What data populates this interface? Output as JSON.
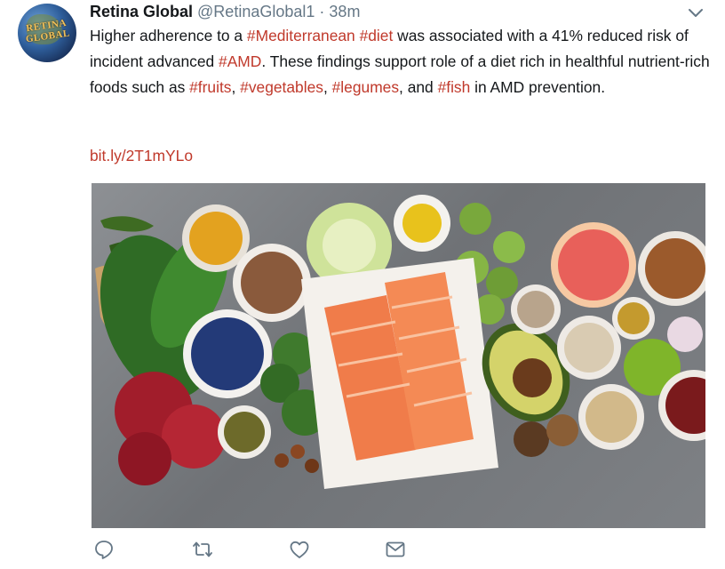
{
  "tweet": {
    "avatar_text": "RETINA GLOBAL",
    "display_name": "Retina Global",
    "handle": "@RetinaGlobal1",
    "separator": "·",
    "time": "38m",
    "text": {
      "p1": "Higher adherence to a ",
      "h1": "#Mediterranean",
      "p2": " ",
      "h2": "#diet",
      "p3": " was associated with a 41% reduced risk of incident advanced ",
      "h3": "#AMD",
      "p4": ". These findings support role of a diet rich in healthful nutrient-rich foods such as ",
      "h4": "#fruits",
      "p5": ", ",
      "h5": "#vegetables",
      "p6": ", ",
      "h6": "#legumes",
      "p7": ", and ",
      "h7": "#fish",
      "p8": " in AMD prevention."
    },
    "link": "bit.ly/2T1mYLo"
  },
  "actions": [
    "reply-icon",
    "retweet-icon",
    "like-icon",
    "direct-message-icon"
  ],
  "colors": {
    "hashtag": "#c0392b",
    "secondary_text": "#657786",
    "icon": "#657786"
  }
}
